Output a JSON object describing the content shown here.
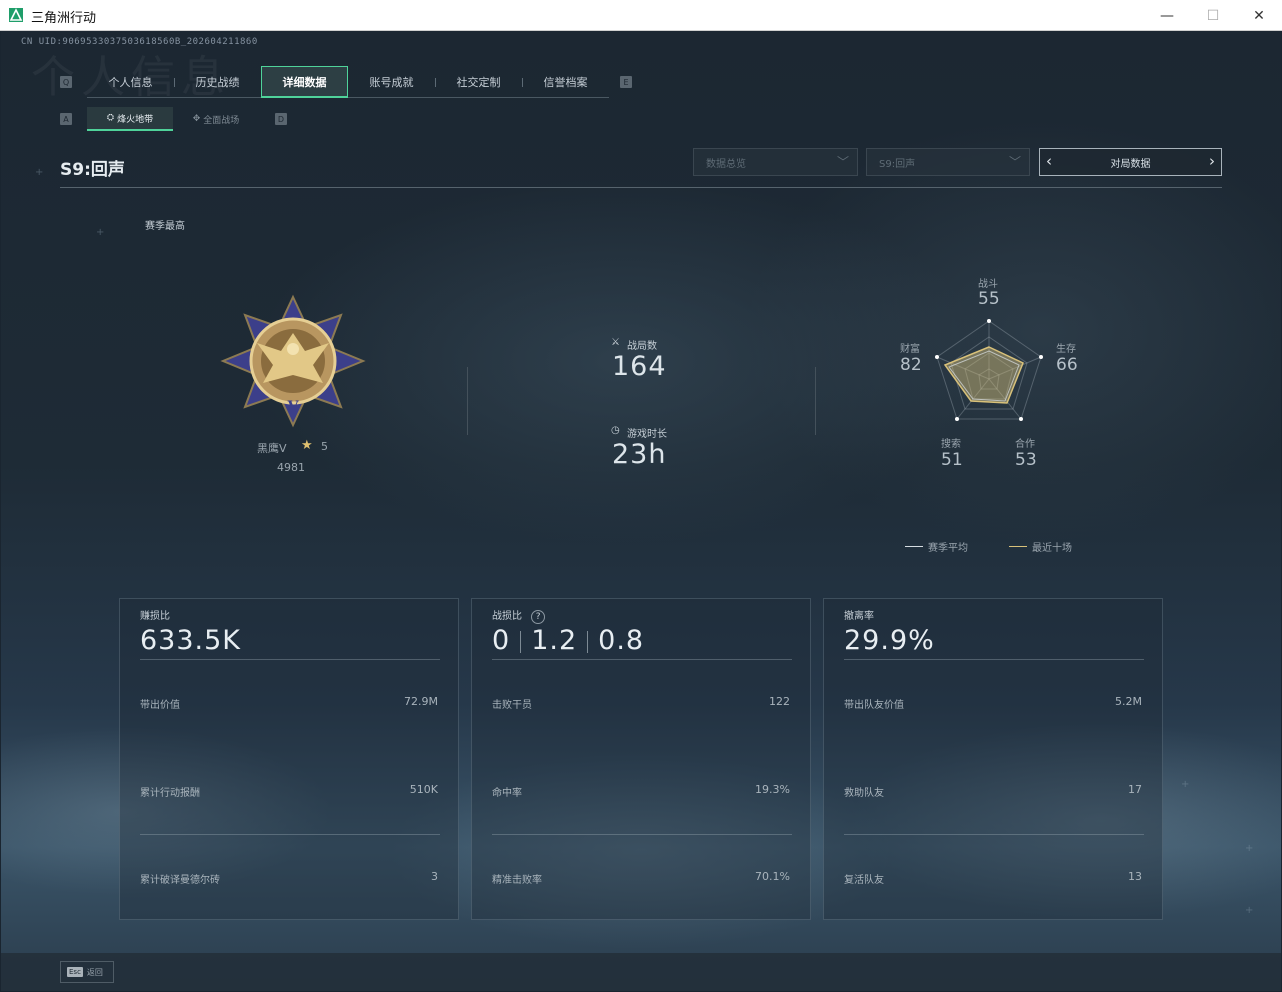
{
  "window": {
    "title": "三角洲行动",
    "min": "—",
    "max": "☐",
    "close": "✕"
  },
  "uid": "CN UID:9069533037503618560B_202604211860",
  "bg_title": "个人信息",
  "keys": {
    "q": "Q",
    "e": "E",
    "a": "A",
    "d": "D"
  },
  "tabs": [
    "个人信息",
    "历史战绩",
    "详细数据",
    "账号成就",
    "社交定制",
    "信誉档案"
  ],
  "active_tab": 2,
  "subtabs": [
    "烽火地带",
    "全面战场"
  ],
  "season_title": "S9:回声",
  "filters": {
    "data": "数据总览",
    "season": "S9:回声",
    "match": "对局数据"
  },
  "season_best": "赛季最高",
  "rank": {
    "name": "黑鹰V",
    "stars": "5",
    "score": "4981"
  },
  "matches": {
    "label": "战局数",
    "value": "164"
  },
  "playtime": {
    "label": "游戏时长",
    "value": "23h"
  },
  "radar": {
    "combat": {
      "label": "战斗",
      "value": "55"
    },
    "survival": {
      "label": "生存",
      "value": "66"
    },
    "teamwork": {
      "label": "合作",
      "value": "53"
    },
    "search": {
      "label": "搜索",
      "value": "51"
    },
    "wealth": {
      "label": "财富",
      "value": "82"
    }
  },
  "legend": {
    "avg": "赛季平均",
    "recent": "最近十场"
  },
  "colors": {
    "accent": "#4fd39a",
    "gold": "#d8c17a"
  },
  "panels": [
    {
      "title": "赚损比",
      "big": "633.5K",
      "rows": [
        {
          "label": "带出价值",
          "value": "72.9M"
        },
        {
          "label": "累计行动报酬",
          "value": "510K"
        },
        {
          "label": "累计破译曼德尔砖",
          "value": "3"
        }
      ]
    },
    {
      "title": "战损比",
      "help": "?",
      "kd": [
        "0",
        "1.2",
        "0.8"
      ],
      "rows": [
        {
          "label": "击败干员",
          "value": "122"
        },
        {
          "label": "命中率",
          "value": "19.3%"
        },
        {
          "label": "精准击败率",
          "value": "70.1%"
        }
      ]
    },
    {
      "title": "撤离率",
      "big": "29.9%",
      "rows": [
        {
          "label": "带出队友价值",
          "value": "5.2M"
        },
        {
          "label": "救助队友",
          "value": "17"
        },
        {
          "label": "复活队友",
          "value": "13"
        }
      ]
    }
  ],
  "esc": {
    "key": "Esc",
    "label": "返回"
  }
}
